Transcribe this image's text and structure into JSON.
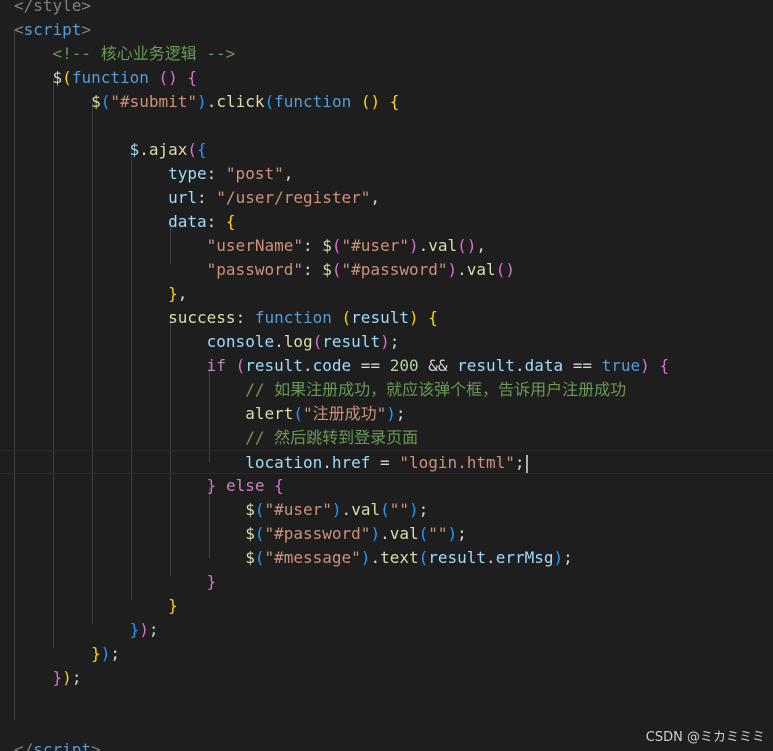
{
  "lines": [
    [
      {
        "t": "</style>",
        "c": "t-tag"
      }
    ],
    [
      {
        "t": "<",
        "c": "t-tag"
      },
      {
        "t": "script",
        "c": "t-tagname"
      },
      {
        "t": ">",
        "c": "t-tag"
      }
    ],
    [
      {
        "t": "    "
      },
      {
        "t": "<!-- 核心业务逻辑 -->",
        "c": "t-comment"
      }
    ],
    [
      {
        "t": "    "
      },
      {
        "t": "$",
        "c": "t-fn"
      },
      {
        "t": "(",
        "c": "t-b1"
      },
      {
        "t": "function",
        "c": "t-kw"
      },
      {
        "t": " "
      },
      {
        "t": "()",
        "c": "t-b2"
      },
      {
        "t": " "
      },
      {
        "t": "{",
        "c": "t-b2"
      }
    ],
    [
      {
        "t": "        "
      },
      {
        "t": "$",
        "c": "t-fn"
      },
      {
        "t": "(",
        "c": "t-b3"
      },
      {
        "t": "\"#submit\"",
        "c": "t-str"
      },
      {
        "t": ")",
        "c": "t-b3"
      },
      {
        "t": "."
      },
      {
        "t": "click",
        "c": "t-fn"
      },
      {
        "t": "(",
        "c": "t-b3"
      },
      {
        "t": "function",
        "c": "t-kw"
      },
      {
        "t": " "
      },
      {
        "t": "()",
        "c": "t-b1"
      },
      {
        "t": " "
      },
      {
        "t": "{",
        "c": "t-b1"
      }
    ],
    [],
    [
      {
        "t": "            "
      },
      {
        "t": "$",
        "c": "t-var"
      },
      {
        "t": "."
      },
      {
        "t": "ajax",
        "c": "t-fn"
      },
      {
        "t": "(",
        "c": "t-b2"
      },
      {
        "t": "{",
        "c": "t-b3"
      }
    ],
    [
      {
        "t": "                "
      },
      {
        "t": "type",
        "c": "t-var"
      },
      {
        "t": ": "
      },
      {
        "t": "\"post\"",
        "c": "t-str"
      },
      {
        "t": ","
      }
    ],
    [
      {
        "t": "                "
      },
      {
        "t": "url",
        "c": "t-var"
      },
      {
        "t": ": "
      },
      {
        "t": "\"/user/register\"",
        "c": "t-str"
      },
      {
        "t": ","
      }
    ],
    [
      {
        "t": "                "
      },
      {
        "t": "data",
        "c": "t-var"
      },
      {
        "t": ": "
      },
      {
        "t": "{",
        "c": "t-b1"
      }
    ],
    [
      {
        "t": "                    "
      },
      {
        "t": "\"userName\"",
        "c": "t-str"
      },
      {
        "t": ": "
      },
      {
        "t": "$",
        "c": "t-fn"
      },
      {
        "t": "(",
        "c": "t-b2"
      },
      {
        "t": "\"#user\"",
        "c": "t-str"
      },
      {
        "t": ")",
        "c": "t-b2"
      },
      {
        "t": "."
      },
      {
        "t": "val",
        "c": "t-fn"
      },
      {
        "t": "()",
        "c": "t-b2"
      },
      {
        "t": ","
      }
    ],
    [
      {
        "t": "                    "
      },
      {
        "t": "\"password\"",
        "c": "t-str"
      },
      {
        "t": ": "
      },
      {
        "t": "$",
        "c": "t-fn"
      },
      {
        "t": "(",
        "c": "t-b2"
      },
      {
        "t": "\"#password\"",
        "c": "t-str"
      },
      {
        "t": ")",
        "c": "t-b2"
      },
      {
        "t": "."
      },
      {
        "t": "val",
        "c": "t-fn"
      },
      {
        "t": "()",
        "c": "t-b2"
      }
    ],
    [
      {
        "t": "                "
      },
      {
        "t": "}",
        "c": "t-b1"
      },
      {
        "t": ","
      }
    ],
    [
      {
        "t": "                "
      },
      {
        "t": "success",
        "c": "t-fn"
      },
      {
        "t": ": "
      },
      {
        "t": "function",
        "c": "t-kw"
      },
      {
        "t": " "
      },
      {
        "t": "(",
        "c": "t-b1"
      },
      {
        "t": "result",
        "c": "t-var"
      },
      {
        "t": ")",
        "c": "t-b1"
      },
      {
        "t": " "
      },
      {
        "t": "{",
        "c": "t-b1"
      }
    ],
    [
      {
        "t": "                    "
      },
      {
        "t": "console",
        "c": "t-var"
      },
      {
        "t": "."
      },
      {
        "t": "log",
        "c": "t-fn"
      },
      {
        "t": "(",
        "c": "t-b2"
      },
      {
        "t": "result",
        "c": "t-var"
      },
      {
        "t": ")",
        "c": "t-b2"
      },
      {
        "t": ";"
      }
    ],
    [
      {
        "t": "                    "
      },
      {
        "t": "if",
        "c": "t-ctl"
      },
      {
        "t": " "
      },
      {
        "t": "(",
        "c": "t-b2"
      },
      {
        "t": "result",
        "c": "t-var"
      },
      {
        "t": "."
      },
      {
        "t": "code",
        "c": "t-var"
      },
      {
        "t": " == "
      },
      {
        "t": "200",
        "c": "t-num"
      },
      {
        "t": " && "
      },
      {
        "t": "result",
        "c": "t-var"
      },
      {
        "t": "."
      },
      {
        "t": "data",
        "c": "t-var"
      },
      {
        "t": " == "
      },
      {
        "t": "true",
        "c": "t-kw"
      },
      {
        "t": ")",
        "c": "t-b2"
      },
      {
        "t": " "
      },
      {
        "t": "{",
        "c": "t-b2"
      }
    ],
    [
      {
        "t": "                        "
      },
      {
        "t": "// 如果注册成功，就应该弹个框，告诉用户注册成功",
        "c": "t-comment"
      }
    ],
    [
      {
        "t": "                        "
      },
      {
        "t": "alert",
        "c": "t-fn"
      },
      {
        "t": "(",
        "c": "t-b3"
      },
      {
        "t": "\"注册成功\"",
        "c": "t-str"
      },
      {
        "t": ")",
        "c": "t-b3"
      },
      {
        "t": ";"
      }
    ],
    [
      {
        "t": "                        "
      },
      {
        "t": "// 然后跳转到登录页面",
        "c": "t-comment"
      }
    ],
    [
      {
        "t": "                        "
      },
      {
        "t": "location",
        "c": "t-var"
      },
      {
        "t": "."
      },
      {
        "t": "href",
        "c": "t-var"
      },
      {
        "t": " = "
      },
      {
        "t": "\"login.html\"",
        "c": "t-str"
      },
      {
        "t": ";"
      }
    ],
    [
      {
        "t": "                    "
      },
      {
        "t": "}",
        "c": "t-b2"
      },
      {
        "t": " "
      },
      {
        "t": "else",
        "c": "t-ctl"
      },
      {
        "t": " "
      },
      {
        "t": "{",
        "c": "t-b2"
      }
    ],
    [
      {
        "t": "                        "
      },
      {
        "t": "$",
        "c": "t-fn"
      },
      {
        "t": "(",
        "c": "t-b3"
      },
      {
        "t": "\"#user\"",
        "c": "t-str"
      },
      {
        "t": ")",
        "c": "t-b3"
      },
      {
        "t": "."
      },
      {
        "t": "val",
        "c": "t-fn"
      },
      {
        "t": "(",
        "c": "t-b3"
      },
      {
        "t": "\"\"",
        "c": "t-str"
      },
      {
        "t": ")",
        "c": "t-b3"
      },
      {
        "t": ";"
      }
    ],
    [
      {
        "t": "                        "
      },
      {
        "t": "$",
        "c": "t-fn"
      },
      {
        "t": "(",
        "c": "t-b3"
      },
      {
        "t": "\"#password\"",
        "c": "t-str"
      },
      {
        "t": ")",
        "c": "t-b3"
      },
      {
        "t": "."
      },
      {
        "t": "val",
        "c": "t-fn"
      },
      {
        "t": "(",
        "c": "t-b3"
      },
      {
        "t": "\"\"",
        "c": "t-str"
      },
      {
        "t": ")",
        "c": "t-b3"
      },
      {
        "t": ";"
      }
    ],
    [
      {
        "t": "                        "
      },
      {
        "t": "$",
        "c": "t-fn"
      },
      {
        "t": "(",
        "c": "t-b3"
      },
      {
        "t": "\"#message\"",
        "c": "t-str"
      },
      {
        "t": ")",
        "c": "t-b3"
      },
      {
        "t": "."
      },
      {
        "t": "text",
        "c": "t-fn"
      },
      {
        "t": "(",
        "c": "t-b3"
      },
      {
        "t": "result",
        "c": "t-var"
      },
      {
        "t": "."
      },
      {
        "t": "errMsg",
        "c": "t-var"
      },
      {
        "t": ")",
        "c": "t-b3"
      },
      {
        "t": ";"
      }
    ],
    [
      {
        "t": "                    "
      },
      {
        "t": "}",
        "c": "t-b2"
      }
    ],
    [
      {
        "t": "                "
      },
      {
        "t": "}",
        "c": "t-b1"
      }
    ],
    [
      {
        "t": "            "
      },
      {
        "t": "}",
        "c": "t-b3"
      },
      {
        "t": ")",
        "c": "t-b2"
      },
      {
        "t": ";"
      }
    ],
    [
      {
        "t": "        "
      },
      {
        "t": "}",
        "c": "t-b1"
      },
      {
        "t": ")",
        "c": "t-b3"
      },
      {
        "t": ";"
      }
    ],
    [
      {
        "t": "    "
      },
      {
        "t": "}",
        "c": "t-b2"
      },
      {
        "t": ")",
        "c": "t-b1"
      },
      {
        "t": ";"
      }
    ],
    [],
    [],
    [
      {
        "t": "</",
        "c": "t-tag"
      },
      {
        "t": "script",
        "c": "t-tagname"
      },
      {
        "t": ">",
        "c": "t-tag"
      }
    ]
  ],
  "watermark": "CSDN @ミカミミミ"
}
